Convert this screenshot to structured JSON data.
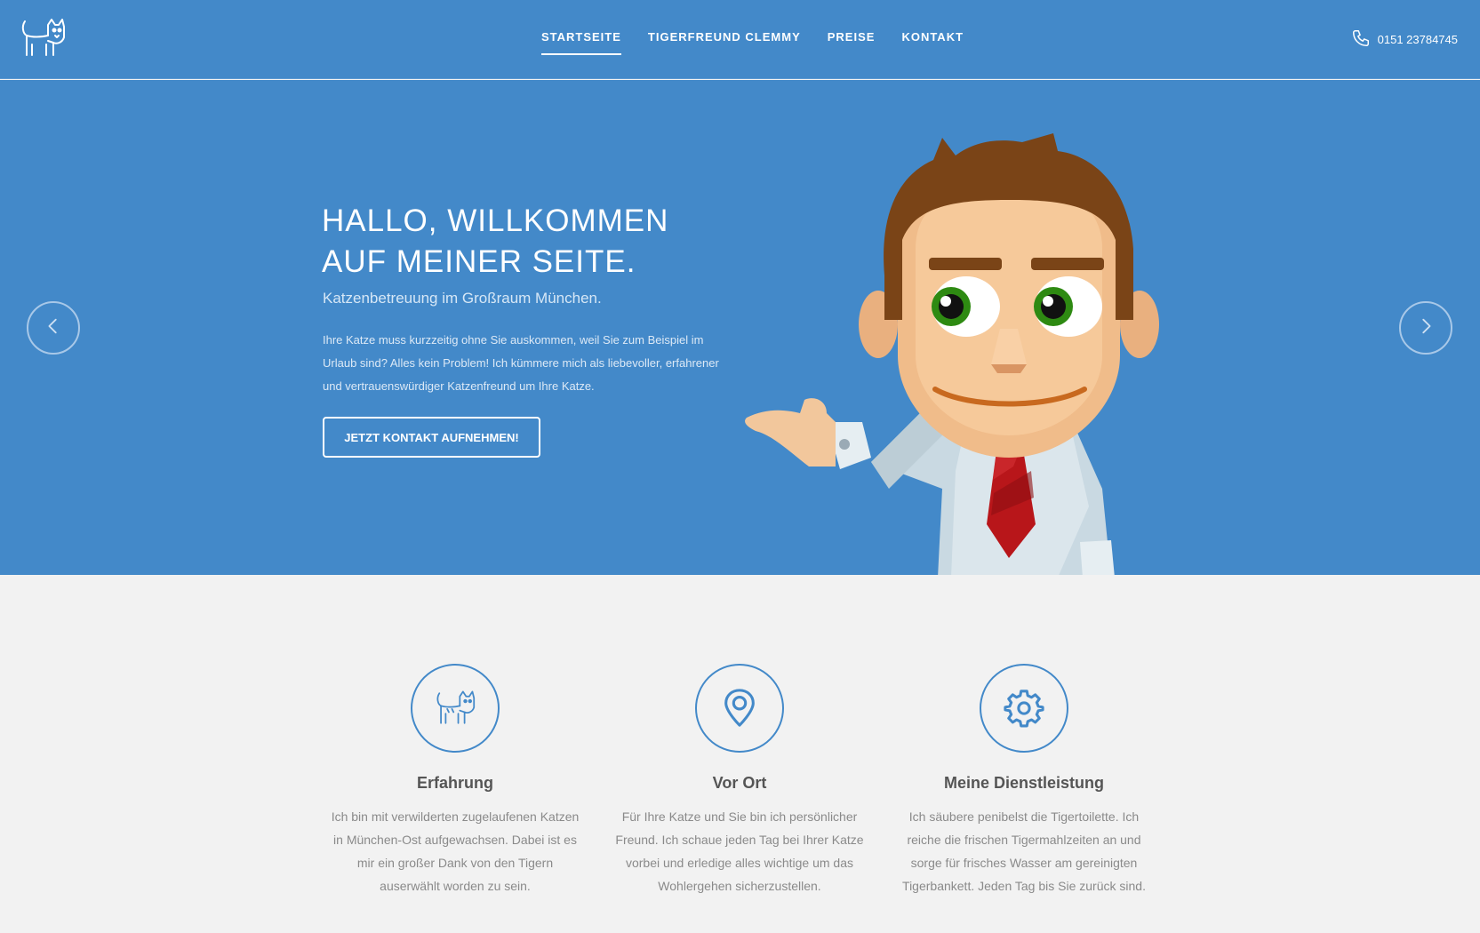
{
  "header": {
    "logo_icon": "cat-logo-icon",
    "nav": [
      {
        "label": "STARTSEITE",
        "active": true
      },
      {
        "label": "TIGERFREUND CLEMMY",
        "active": false
      },
      {
        "label": "PREISE",
        "active": false
      },
      {
        "label": "KONTAKT",
        "active": false
      }
    ],
    "phone_icon": "phone-icon",
    "phone": "0151 23784745"
  },
  "hero": {
    "title": "HALLO, WILLKOMMEN\nAUF MEINER SEITE.",
    "subtitle": "Katzenbetreuung im Großraum München.",
    "text": "Ihre Katze muss kurzzeitig ohne Sie auskommen, weil Sie zum Beispiel im Urlaub sind? Alles kein Problem! Ich kümmere mich als liebevoller, erfahrener und vertrauenswürdiger Katzenfreund um Ihre Katze.",
    "cta": "JETZT KONTAKT AUFNEHMEN!",
    "prev_icon": "chevron-left-icon",
    "next_icon": "chevron-right-icon"
  },
  "features": [
    {
      "icon": "cat-icon",
      "title": "Erfahrung",
      "text": "Ich bin mit verwilderten zugelaufenen Katzen in München-Ost aufgewachsen. Dabei ist es mir ein großer Dank von den Tigern auserwählt worden zu sein."
    },
    {
      "icon": "map-pin-icon",
      "title": "Vor Ort",
      "text": "Für Ihre Katze und Sie bin ich persönlicher Freund. Ich schaue jeden Tag bei Ihrer Katze vorbei und erledige alles wichtige um das Wohlergehen sicherzustellen."
    },
    {
      "icon": "gear-icon",
      "title": "Meine Dienstleistung",
      "text": "Ich säubere penibelst die Tigertoilette. Ich reiche die frischen Tigermahlzeiten an und sorge für frisches Wasser am gereinigten Tigerbankett. Jeden Tag bis Sie zurück sind."
    }
  ],
  "colors": {
    "primary": "#4389c9",
    "background": "#f2f2f2"
  }
}
